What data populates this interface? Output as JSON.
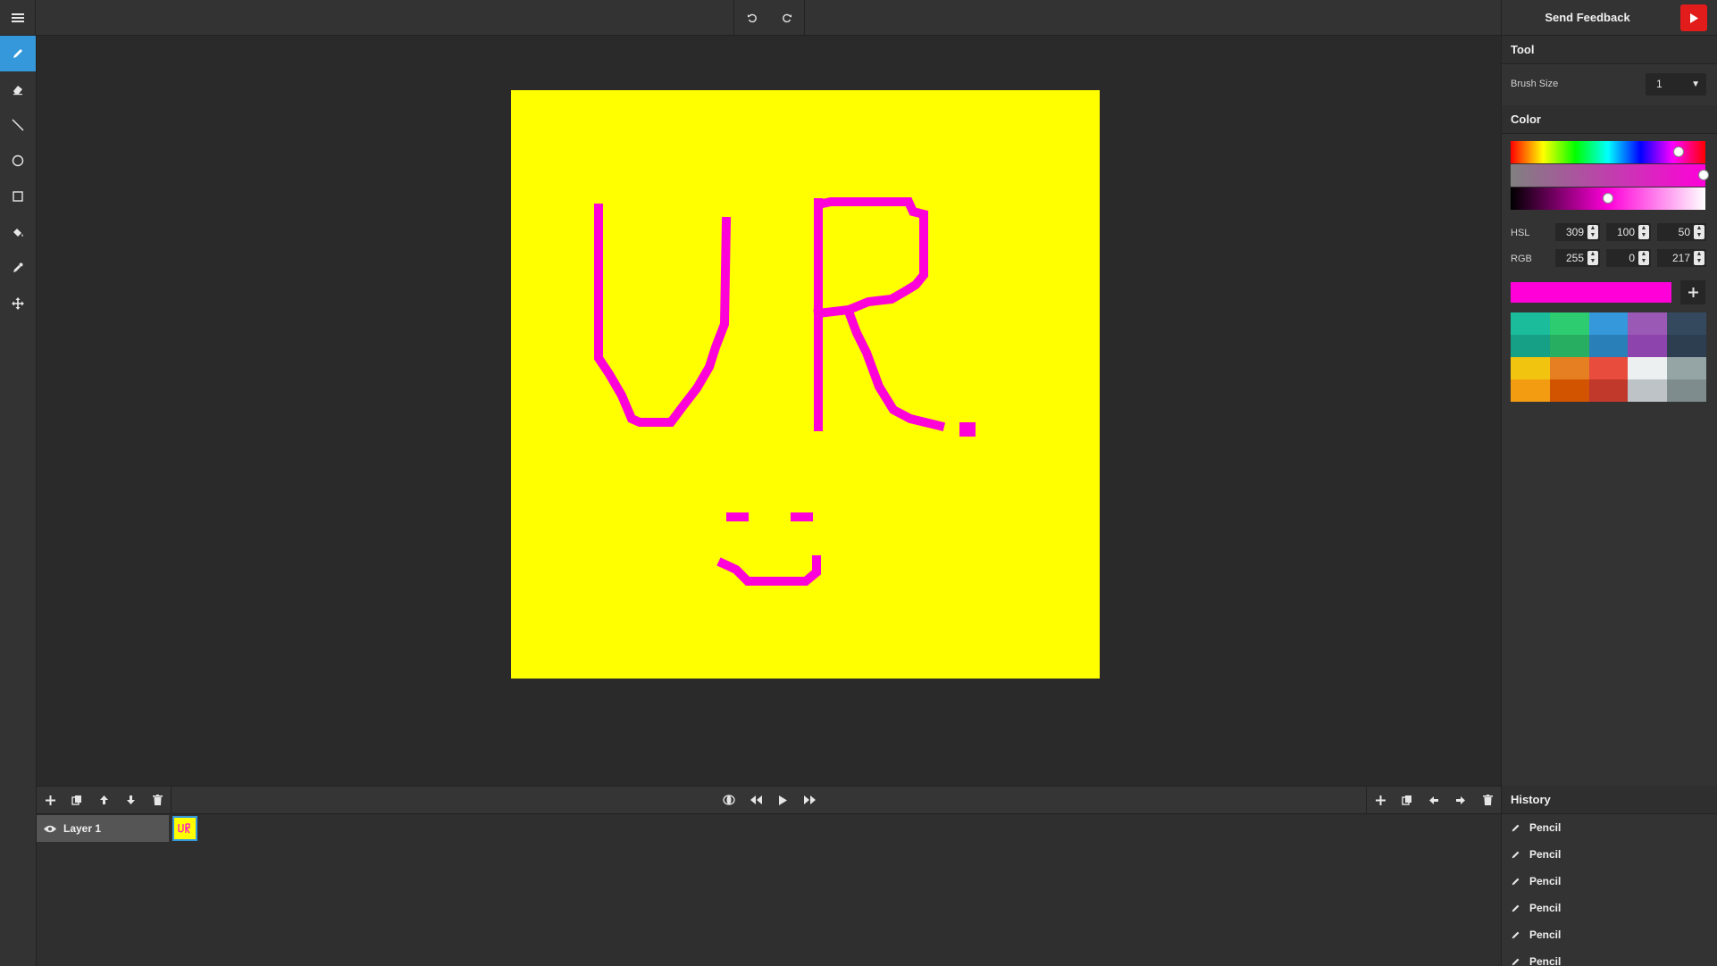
{
  "topbar": {
    "menu_icon": "hamburger-icon",
    "undo_icon": "undo-icon",
    "redo_icon": "redo-icon"
  },
  "tools": [
    {
      "name": "pencil-tool",
      "icon": "pencil-icon",
      "active": true
    },
    {
      "name": "eraser-tool",
      "icon": "eraser-icon",
      "active": false
    },
    {
      "name": "line-tool",
      "icon": "line-icon",
      "active": false
    },
    {
      "name": "ellipse-tool",
      "icon": "circle-icon",
      "active": false
    },
    {
      "name": "rectangle-tool",
      "icon": "square-icon",
      "active": false
    },
    {
      "name": "fill-tool",
      "icon": "paint-bucket-icon",
      "active": false
    },
    {
      "name": "eyedropper-tool",
      "icon": "eyedropper-icon",
      "active": false
    },
    {
      "name": "move-tool",
      "icon": "move-icon",
      "active": false
    }
  ],
  "canvas": {
    "background": "#ffff00",
    "stroke_color": "#ff00d9"
  },
  "layers": {
    "items": [
      {
        "name": "Layer 1",
        "visible": true
      }
    ]
  },
  "right_panel": {
    "send_feedback": "Send Feedback",
    "tool_section": "Tool",
    "brush_size_label": "Brush Size",
    "brush_size_value": "1",
    "color_section": "Color",
    "hsl_label": "HSL",
    "hsl_values": [
      "309",
      "100",
      "50"
    ],
    "rgb_label": "RGB",
    "rgb_values": [
      "255",
      "0",
      "217"
    ],
    "current_color": "#ff00d9",
    "palette": [
      "#1abc9c",
      "#2ecc71",
      "#3498db",
      "#9b59b6",
      "#34495e",
      "#16a085",
      "#27ae60",
      "#2980b9",
      "#8e44ad",
      "#2c3e50",
      "#f1c40f",
      "#e67e22",
      "#e74c3c",
      "#ecf0f1",
      "#95a5a6",
      "#f39c12",
      "#d35400",
      "#c0392b",
      "#bdc3c7",
      "#7f8c8d"
    ],
    "history_section": "History",
    "history": [
      "Pencil",
      "Pencil",
      "Pencil",
      "Pencil",
      "Pencil",
      "Pencil"
    ]
  }
}
